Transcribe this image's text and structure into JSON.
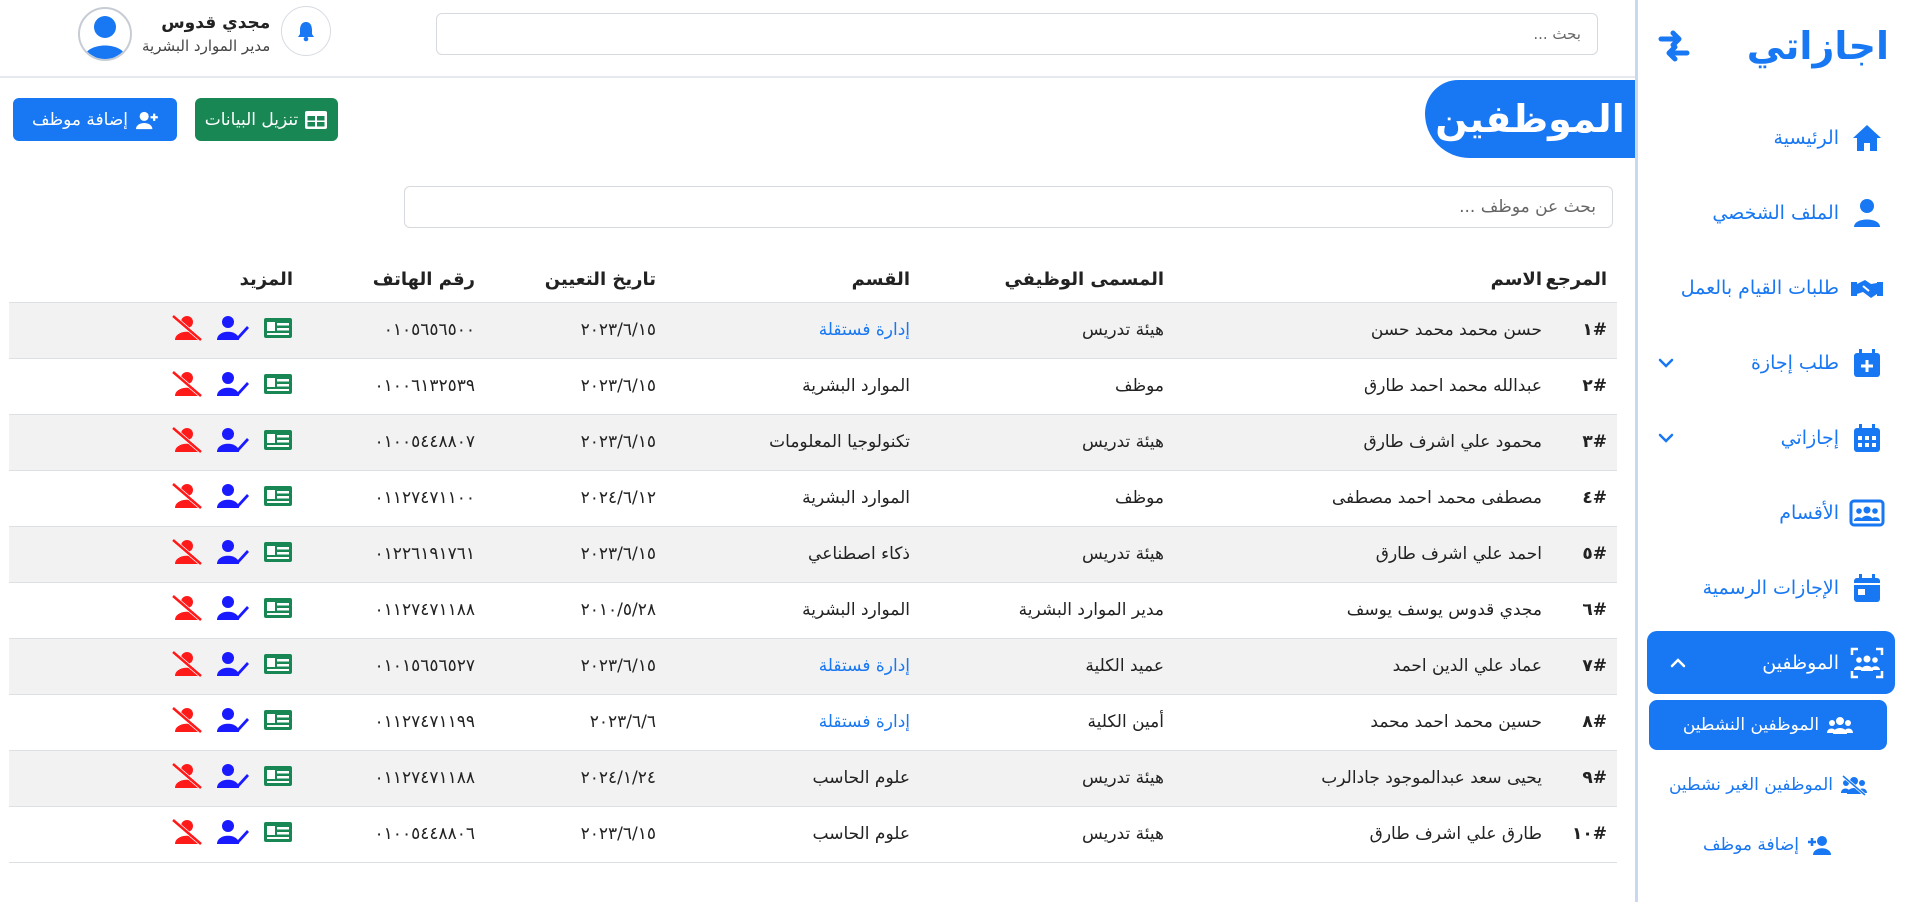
{
  "sidebar": {
    "brand": "اجازاتي",
    "items": [
      {
        "label": "الرئيسية",
        "icon": "home-icon"
      },
      {
        "label": "الملف الشخصي",
        "icon": "user-icon"
      },
      {
        "label": "طلبات القيام بالعمل",
        "icon": "handshake-icon"
      },
      {
        "label": "طلب إجازة",
        "icon": "calendar-plus-icon"
      },
      {
        "label": "إجازاتي",
        "icon": "calendar-icon"
      },
      {
        "label": "الأقسام",
        "icon": "users-rectangle-icon"
      },
      {
        "label": "الإجازات الرسمية",
        "icon": "calendar-day-icon"
      },
      {
        "label": "الموظفين",
        "icon": "users-scan-icon"
      }
    ],
    "subitems": [
      {
        "label": "الموظفين النشطين",
        "icon": "users-icon"
      },
      {
        "label": "الموظفين الغير نشطين",
        "icon": "users-slash-icon"
      },
      {
        "label": "إضافة موظف",
        "icon": "user-plus-icon"
      }
    ]
  },
  "header": {
    "search_placeholder": "بحث ...",
    "user_name": "مجدي قدوس",
    "user_role": "مدير الموارد البشرية"
  },
  "page": {
    "title": "الموظفين",
    "download_label": "تنزيل البيانات",
    "add_label": "إضافة موظف",
    "search_placeholder": "بحث عن موظف ..."
  },
  "colors": {
    "primary": "#1877f2",
    "success": "#198754",
    "danger": "#ff1a1a"
  },
  "table": {
    "headers": [
      "المرجع",
      "الاسم",
      "المسمى الوظيفي",
      "القسم",
      "تاريخ التعيين",
      "رقم الهاتف",
      "المزيد"
    ],
    "rows": [
      {
        "ref": "#١",
        "name": "حسن محمد محمد حسن",
        "title": "هيئة تدريس",
        "dept": "إدارة فستقلة",
        "dept_link": true,
        "date": "٢٠٢٣/٦/١٥",
        "phone": "٠١٠٥٦٥٦٥٠٠"
      },
      {
        "ref": "#٢",
        "name": "عبدالله محمد احمد طارق",
        "title": "موظف",
        "dept": "الموارد البشرية",
        "dept_link": false,
        "date": "٢٠٢٣/٦/١٥",
        "phone": "٠١٠٠٦١٣٢٥٣٩"
      },
      {
        "ref": "#٣",
        "name": "محمود علي اشرف طارق",
        "title": "هيئة تدريس",
        "dept": "تكنولوجيا المعلومات",
        "dept_link": false,
        "date": "٢٠٢٣/٦/١٥",
        "phone": "٠١٠٠٥٤٤٨٨٠٧"
      },
      {
        "ref": "#٤",
        "name": "مصطفى محمد احمد مصطفى",
        "title": "موظف",
        "dept": "الموارد البشرية",
        "dept_link": false,
        "date": "٢٠٢٤/٦/١٢",
        "phone": "٠١١٢٧٤٧١١٠٠"
      },
      {
        "ref": "#٥",
        "name": "احمد علي اشرف طارق",
        "title": "هيئة تدريس",
        "dept": "ذكاء اصطناعي",
        "dept_link": false,
        "date": "٢٠٢٣/٦/١٥",
        "phone": "٠١٢٢٦١٩١٧٦١"
      },
      {
        "ref": "#٦",
        "name": "مجدي قدوس يوسف يوسف",
        "title": "مدير الموارد البشرية",
        "dept": "الموارد البشرية",
        "dept_link": false,
        "date": "٢٠١٠/٥/٢٨",
        "phone": "٠١١٢٧٤٧١١٨٨"
      },
      {
        "ref": "#٧",
        "name": "عماد علي الدين احمد",
        "title": "عميد الكلية",
        "dept": "إدارة فستقلة",
        "dept_link": true,
        "date": "٢٠٢٣/٦/١٥",
        "phone": "٠١٠١٥٦٥٦٥٢٧"
      },
      {
        "ref": "#٨",
        "name": "حسين محمد احمد محمد",
        "title": "أمين الكلية",
        "dept": "إدارة فستقلة",
        "dept_link": true,
        "date": "٢٠٢٣/٦/٦",
        "phone": "٠١١٢٧٤٧١١٩٩"
      },
      {
        "ref": "#٩",
        "name": "يحيى سعد عبدالموجود جادالرب",
        "title": "هيئة تدريس",
        "dept": "علوم الحاسب",
        "dept_link": false,
        "date": "٢٠٢٤/١/٢٤",
        "phone": "٠١١٢٧٤٧١١٨٨"
      },
      {
        "ref": "#١٠",
        "name": "طارق علي اشرف طارق",
        "title": "هيئة تدريس",
        "dept": "علوم الحاسب",
        "dept_link": false,
        "date": "٢٠٢٣/٦/١٥",
        "phone": "٠١٠٠٥٤٤٨٨٠٦"
      }
    ]
  }
}
